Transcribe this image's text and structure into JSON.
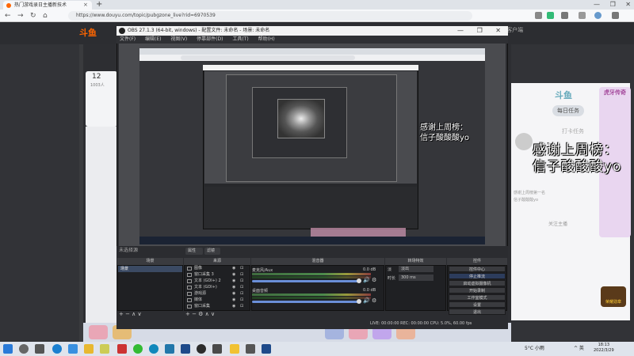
{
  "browser": {
    "tab_title": "热门游戏录日主播新技术",
    "url": "https://www.douyu.com/topic/pubgzone_live?rid=6970539",
    "tab_close": "×",
    "tab_new": "+",
    "window_controls": "— ❐ ✕"
  },
  "douyu": {
    "logo": "斗鱼",
    "header_right": "PC客户端",
    "card_number": "12",
    "card_count": "1003人",
    "panel_logo": "斗鱼",
    "daily_task": "每日任务",
    "side_title": "虎牙传奇",
    "dakar": "打卡任务",
    "chat_text": "感谢上周榜第一名信子酸酸酸yo",
    "follow_text": "关注主播",
    "overlay_line1": "感谢上周榜：",
    "overlay_line2": "信子酸酸酸yo",
    "badge": "荣耀勋章"
  },
  "obs": {
    "title": "OBS 27.1.3 (64-bit, windows) - 配置文件: 未命名 - 场景: 未命名",
    "menu": "文件(F) 编辑(E) 视图(V) 停靠部件(D) 工具(T) 帮助(H)",
    "window_controls": "— ❐ ✕",
    "preview_overlay_line1": "感谢上周榜：",
    "preview_overlay_line2": "信子酸酸酸yo",
    "no_source": "未选择源",
    "filter_label": "属性",
    "filter_label2": "滤镜",
    "dock_scenes": "场景",
    "dock_sources": "来源",
    "dock_mixer": "混音器",
    "dock_transitions": "转场特效",
    "dock_controls": "控件",
    "scene_item": "场景",
    "sources": [
      {
        "name": "图像"
      },
      {
        "name": "窗口采集 3"
      },
      {
        "name": "文本 (GDI+) 2"
      },
      {
        "name": "文本 (GDI+)"
      },
      {
        "name": "游戏源"
      },
      {
        "name": "媒体"
      },
      {
        "name": "窗口采集"
      }
    ],
    "dock_footer_symbols": "+ − ∧ ∨",
    "source_footer_symbols": "+ − ⚙ ∧ ∨",
    "mixer": {
      "ch1": "麦克风/Aux",
      "db1": "0.0 dB",
      "ch2": "桌面音频",
      "db2": "0.0 dB",
      "vol_symbol": "🔊 ⚙"
    },
    "transition": {
      "type": "淡出",
      "duration_label": "时长",
      "duration": "300 ms",
      "fade_label": "淡"
    },
    "controls": [
      "控件中心",
      "停止推流",
      "启动虚拟摄像机",
      "开始录制",
      "工作室模式",
      "设置",
      "退出"
    ],
    "status": "LIVE: 00:00:00   REC: 00:00:00   CPU: 5.0%, 60.00 fps"
  },
  "taskbar": {
    "weather": "5°C 小雨",
    "tray": "^ 英",
    "time": "18:13",
    "date": "2022/3/29"
  },
  "colors": {
    "accent": "#f60",
    "obs_dark": "#2b2c30",
    "select": "#3b4a63"
  }
}
